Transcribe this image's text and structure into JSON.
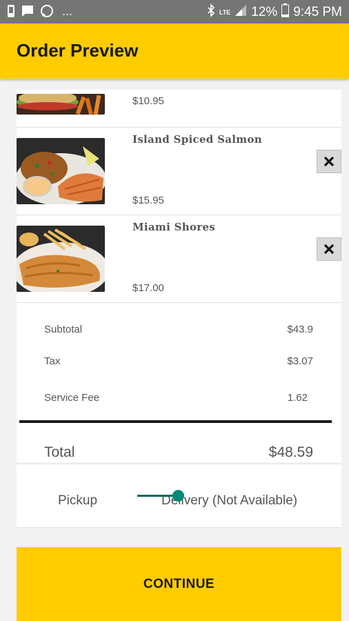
{
  "status_bar": {
    "lte": "LTE",
    "battery": "12%",
    "time": "9:45 PM",
    "overflow": "..."
  },
  "app_bar": {
    "title": "Order Preview"
  },
  "order_items": [
    {
      "name": "",
      "price": "$10.95",
      "image": "burger-fries-photo",
      "removable": false
    },
    {
      "name": "Island Spiced Salmon",
      "price": "$15.95",
      "image": "salmon-rice-photo",
      "removable": true
    },
    {
      "name": "Miami Shores",
      "price": "$17.00",
      "image": "fried-fish-photo",
      "removable": true
    }
  ],
  "summary": {
    "subtotal_label": "Subtotal",
    "subtotal_value": "$43.9",
    "tax_label": "Tax",
    "tax_value": "$3.07",
    "service_fee_label": "Service Fee",
    "service_fee_value": "1.62",
    "total_label": "Total",
    "total_value": "$48.59"
  },
  "fulfillment": {
    "pickup_label": "Pickup",
    "delivery_label": "Delivery (Not Available)",
    "selected": "Pickup"
  },
  "continue_label": "CONTINUE",
  "colors": {
    "brand": "#ffcc00",
    "status_bar": "#757575",
    "toggle_accent": "#00897b"
  }
}
